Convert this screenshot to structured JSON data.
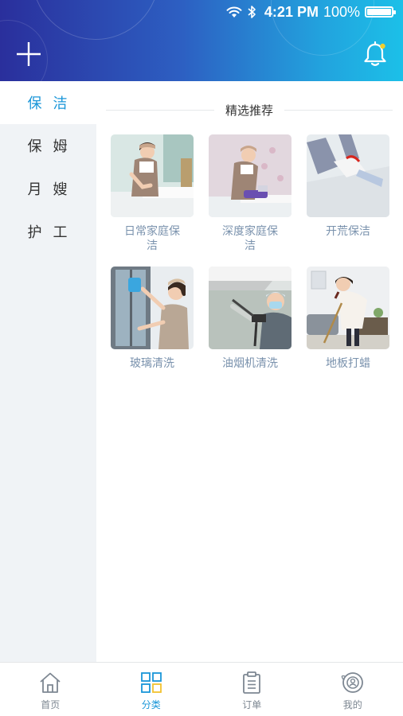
{
  "status_bar": {
    "time": "4:21 PM",
    "battery_percent": "100%",
    "icons": [
      "wifi-icon",
      "bluetooth-icon",
      "battery-icon"
    ]
  },
  "header": {
    "left_icon": "plus-icon",
    "right_icon": "bell-icon",
    "gradient_colors": [
      "#2a2f9c",
      "#22a3de",
      "#1cc0e8"
    ]
  },
  "sidebar": {
    "items": [
      {
        "label": "保洁",
        "active": true
      },
      {
        "label": "保姆",
        "active": false
      },
      {
        "label": "月嫂",
        "active": false
      },
      {
        "label": "护工",
        "active": false
      }
    ]
  },
  "main": {
    "section_title": "精选推荐",
    "services": [
      {
        "label": "日常家庭保洁",
        "image": "maid-cleaning-bed"
      },
      {
        "label": "深度家庭保洁",
        "image": "maid-vacuuming-mattress"
      },
      {
        "label": "开荒保洁",
        "image": "gloved-hand-scraping-floor"
      },
      {
        "label": "玻璃清洗",
        "image": "woman-wiping-window"
      },
      {
        "label": "油烟机清洗",
        "image": "man-steam-cleaning-range-hood"
      },
      {
        "label": "地板打蜡",
        "image": "woman-waxing-floor"
      }
    ]
  },
  "tabbar": {
    "tabs": [
      {
        "label": "首页",
        "icon": "home-icon",
        "active": false
      },
      {
        "label": "分类",
        "icon": "grid-icon",
        "active": true
      },
      {
        "label": "订单",
        "icon": "clipboard-icon",
        "active": false
      },
      {
        "label": "我的",
        "icon": "user-profile-icon",
        "active": false
      }
    ]
  },
  "colors": {
    "accent": "#1a96d8",
    "sidebar_bg": "#f0f3f6",
    "label_gray_blue": "#7a92ad",
    "grid_icon_yellow": "#f2c230"
  }
}
